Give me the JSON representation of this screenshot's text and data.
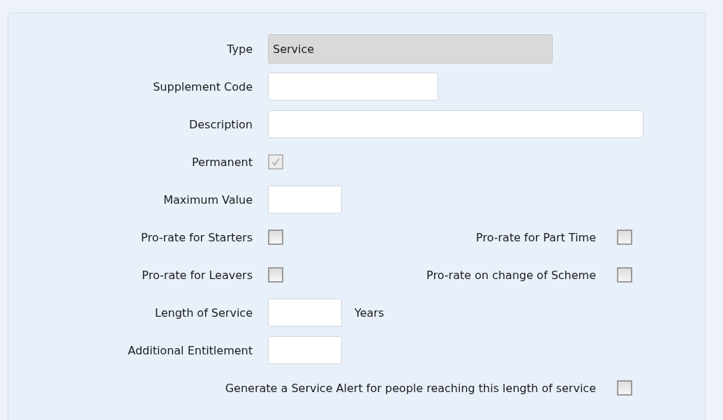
{
  "fields": [
    {
      "kind": "text",
      "label": "Type",
      "value": "Service",
      "disabled": true
    },
    {
      "kind": "text",
      "label": "Supplement Code"
    },
    {
      "kind": "text",
      "label": "Description"
    },
    {
      "kind": "checkbox",
      "label": "Permanent",
      "checked": true,
      "disabled": true
    },
    {
      "kind": "text",
      "label": "Maximum Value"
    },
    {
      "kind": "checkbox",
      "label": "Pro-rate for Starters",
      "checked": false,
      "disabled": false,
      "right": {
        "label": "Pro-rate for Part Time",
        "checked": false
      }
    },
    {
      "kind": "checkbox",
      "label": "Pro-rate for Leavers",
      "checked": false,
      "disabled": false,
      "right": {
        "label": "Pro-rate on change of Scheme",
        "checked": false
      }
    },
    {
      "kind": "text",
      "label": "Length of Service",
      "suffix": "Years"
    },
    {
      "kind": "text",
      "label": "Additional Entitlement"
    },
    {
      "kind": "wide-checkbox",
      "label": "Generate a Service Alert for people reaching this length of service",
      "checked": false
    }
  ]
}
